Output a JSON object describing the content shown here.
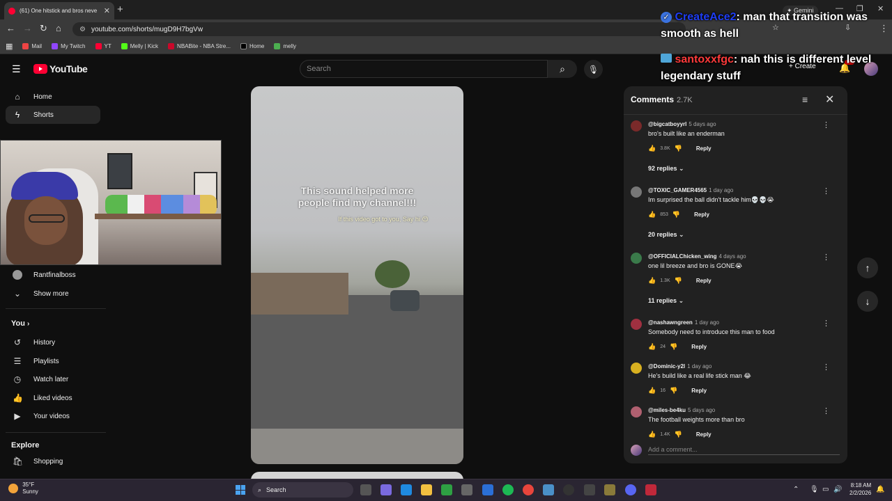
{
  "browser": {
    "tab_title": "(61) One hitstick and bros neve",
    "url": "youtube.com/shorts/mugD9H7bgVw",
    "gemini_label": "Gemini",
    "bookmarks": [
      "Mail",
      "My Twitch",
      "YT",
      "Melly | Kick",
      "NBABite - NBA Stre...",
      "Home",
      "melly"
    ]
  },
  "youtube": {
    "logo_text": "YouTube",
    "search_placeholder": "Search",
    "create_label": "Create",
    "notif_badge": "9+"
  },
  "sidebar": {
    "items_top": [
      {
        "label": "Home",
        "icon": "home-icon"
      },
      {
        "label": "Shorts",
        "icon": "shorts-icon"
      }
    ],
    "subscription": "Rantfinalboss",
    "show_more": "Show more",
    "you_heading": "You",
    "you_items": [
      {
        "label": "History",
        "icon": "history-icon"
      },
      {
        "label": "Playlists",
        "icon": "playlists-icon"
      },
      {
        "label": "Watch later",
        "icon": "watch-later-icon"
      },
      {
        "label": "Liked videos",
        "icon": "like-icon"
      },
      {
        "label": "Your videos",
        "icon": "your-videos-icon"
      }
    ],
    "explore_heading": "Explore",
    "explore_items": [
      {
        "label": "Shopping",
        "icon": "shopping-icon"
      }
    ]
  },
  "video": {
    "caption_line1": "This sound helped more",
    "caption_line2": "people find my channel!!!",
    "caption_sub": "If this video got to you, Say hi 😊"
  },
  "stream_chat": [
    {
      "user": "CreateAce2",
      "message": ": man that transition was smooth as hell"
    },
    {
      "user": "santoxxfgc",
      "message": ": nah this is different level legendary stuff"
    }
  ],
  "comments_panel": {
    "title": "Comments",
    "count": "2.7K",
    "add_placeholder": "Add a comment...",
    "reply_label": "Reply",
    "comments": [
      {
        "author": "@bigcatboyyrl",
        "time": "5 days ago",
        "text": "bro's built like an enderman",
        "likes": "3.8K",
        "replies": "92 replies",
        "avatar_color": "#7a2a2a"
      },
      {
        "author": "@TOXIC_GAMER4565",
        "time": "1 day ago",
        "text": "Im surprised the ball didn't tackle him💀💀😭",
        "likes": "853",
        "replies": "20 replies",
        "avatar_color": "#777"
      },
      {
        "author": "@OFFICIALChicken_wing",
        "time": "4 days ago",
        "text": "one lil breeze and bro is GONE😭",
        "likes": "1.3K",
        "replies": "11 replies",
        "avatar_color": "#3a7a4a"
      },
      {
        "author": "@nashawngreen",
        "time": "1 day ago",
        "text": "Somebody need to introduce this man to food",
        "likes": "24",
        "replies": "",
        "avatar_color": "#a03040"
      },
      {
        "author": "@Dominic-y2l",
        "time": "1 day ago",
        "text": "He's build like a real life stick man 😂",
        "likes": "16",
        "replies": "",
        "avatar_color": "#d8b020"
      },
      {
        "author": "@miles-be4ku",
        "time": "5 days ago",
        "text": "The football weights more than bro",
        "likes": "1.4K",
        "replies": "",
        "avatar_color": "#b06070"
      }
    ]
  },
  "taskbar": {
    "temperature": "35°F",
    "condition": "Sunny",
    "search_label": "Search",
    "time": "8:18 AM",
    "date": "2/2/2026"
  }
}
